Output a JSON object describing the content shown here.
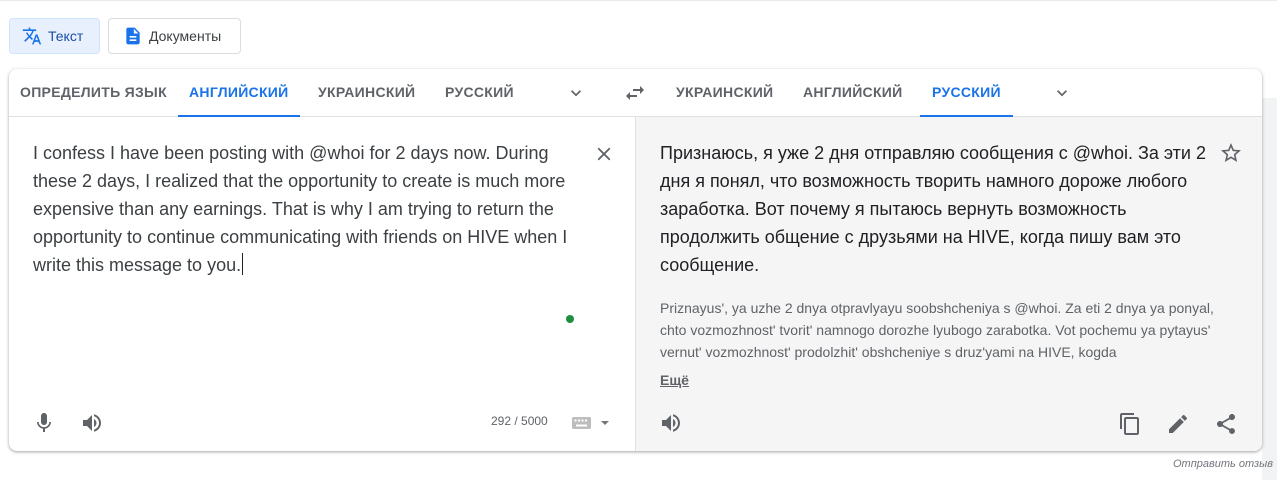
{
  "modes": {
    "text_label": "Текст",
    "docs_label": "Документы"
  },
  "source_langs": {
    "detect": "ОПРЕДЕЛИТЬ ЯЗЫК",
    "english": "АНГЛИЙСКИЙ",
    "ukrainian": "УКРАИНСКИЙ",
    "russian": "РУССКИЙ",
    "active": "english"
  },
  "target_langs": {
    "ukrainian": "УКРАИНСКИЙ",
    "english": "АНГЛИЙСКИЙ",
    "russian": "РУССКИЙ",
    "active": "russian"
  },
  "source": {
    "text": "I confess I have been posting with @whoi for 2 days now. During these 2 days, I realized that the opportunity to create is much more expensive than any earnings. That is why I am trying to return the opportunity to continue communicating with friends on HIVE when I write this message to you.",
    "char_count": "292 / 5000"
  },
  "target": {
    "text": "Признаюсь, я уже 2 дня отправляю сообщения с @whoi. За эти 2 дня я понял, что возможность творить намного дороже любого заработка. Вот почему я пытаюсь вернуть возможность продолжить общение с друзьями на HIVE, когда пишу вам это сообщение.",
    "transliteration": "Priznayus', ya uzhe 2 dnya otpravlyayu soobshcheniya s @whoi. Za eti 2 dnya ya ponyal, chto vozmozhnost' tvorit' namnogo dorozhe lyubogo zarabotka. Vot pochemu ya pytayus' vernut' vozmozhnost' prodolzhit' obshcheniye s druz'yami na HIVE, kogda",
    "more_label": "Ещё"
  },
  "footer": {
    "feedback_label": "Отправить отзыв"
  },
  "colors": {
    "accent": "#1a73e8",
    "text": "#3c4043",
    "muted": "#5f6368",
    "target_bg": "#f5f5f5",
    "indicator_dot": "#1e8e3e"
  },
  "icons": [
    "translate-icon",
    "document-icon",
    "chevron-down-icon",
    "swap-icon",
    "close-icon",
    "mic-icon",
    "speaker-icon",
    "keyboard-icon",
    "star-icon",
    "copy-icon",
    "edit-icon",
    "share-icon"
  ]
}
